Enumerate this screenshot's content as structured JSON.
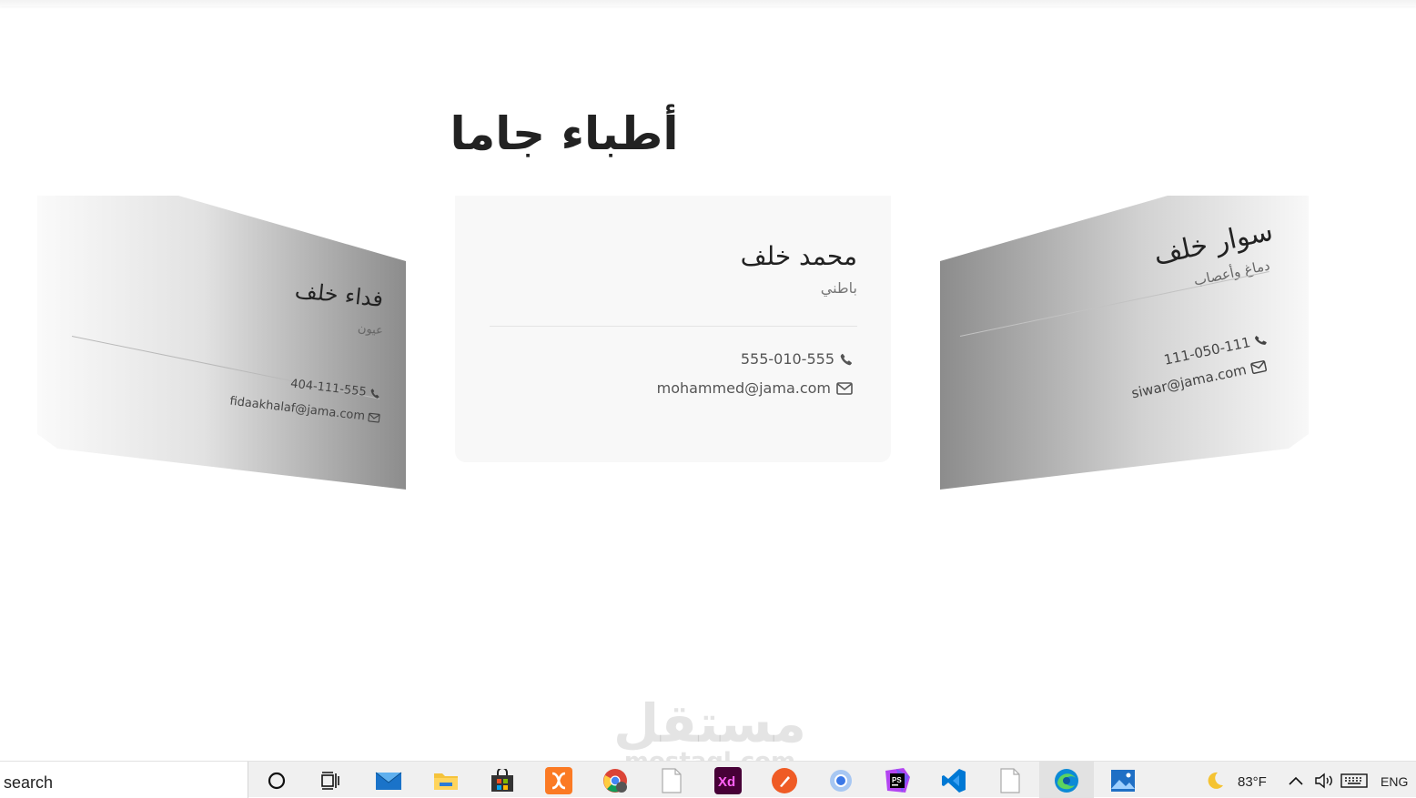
{
  "page": {
    "title": "أطباء جاما",
    "watermark": {
      "arabic": "مستقل",
      "latin": "mostaql.com"
    }
  },
  "cards": {
    "left": {
      "name": "فداء خلف",
      "specialty": "عيون",
      "phone": "404-111-555",
      "email": "fidaakhalaf@jama.com"
    },
    "center": {
      "name": "محمد خلف",
      "specialty": "باطني",
      "phone": "555-010-555",
      "email": "mohammed@jama.com"
    },
    "right": {
      "name": "سوار خلف",
      "specialty": "دماغ وأعصاب",
      "phone": "111-050-111",
      "email": "siwar@jama.com"
    }
  },
  "taskbar": {
    "search_label": "search",
    "apps": [
      "cortana-icon",
      "task-view-icon",
      "mail-icon",
      "file-explorer-icon",
      "store-icon",
      "xampp-icon",
      "chrome-icon",
      "blank-file-icon",
      "adobe-xd-icon",
      "postman-icon",
      "chromium-icon",
      "phpstorm-icon",
      "vscode-icon",
      "blank-file-icon",
      "edge-icon",
      "photos-icon"
    ],
    "weather": "83°F",
    "language": "ENG"
  },
  "colors": {
    "background": "#ffffff",
    "card": "#f8f8f8",
    "text": "#222222",
    "muted": "#777777"
  }
}
